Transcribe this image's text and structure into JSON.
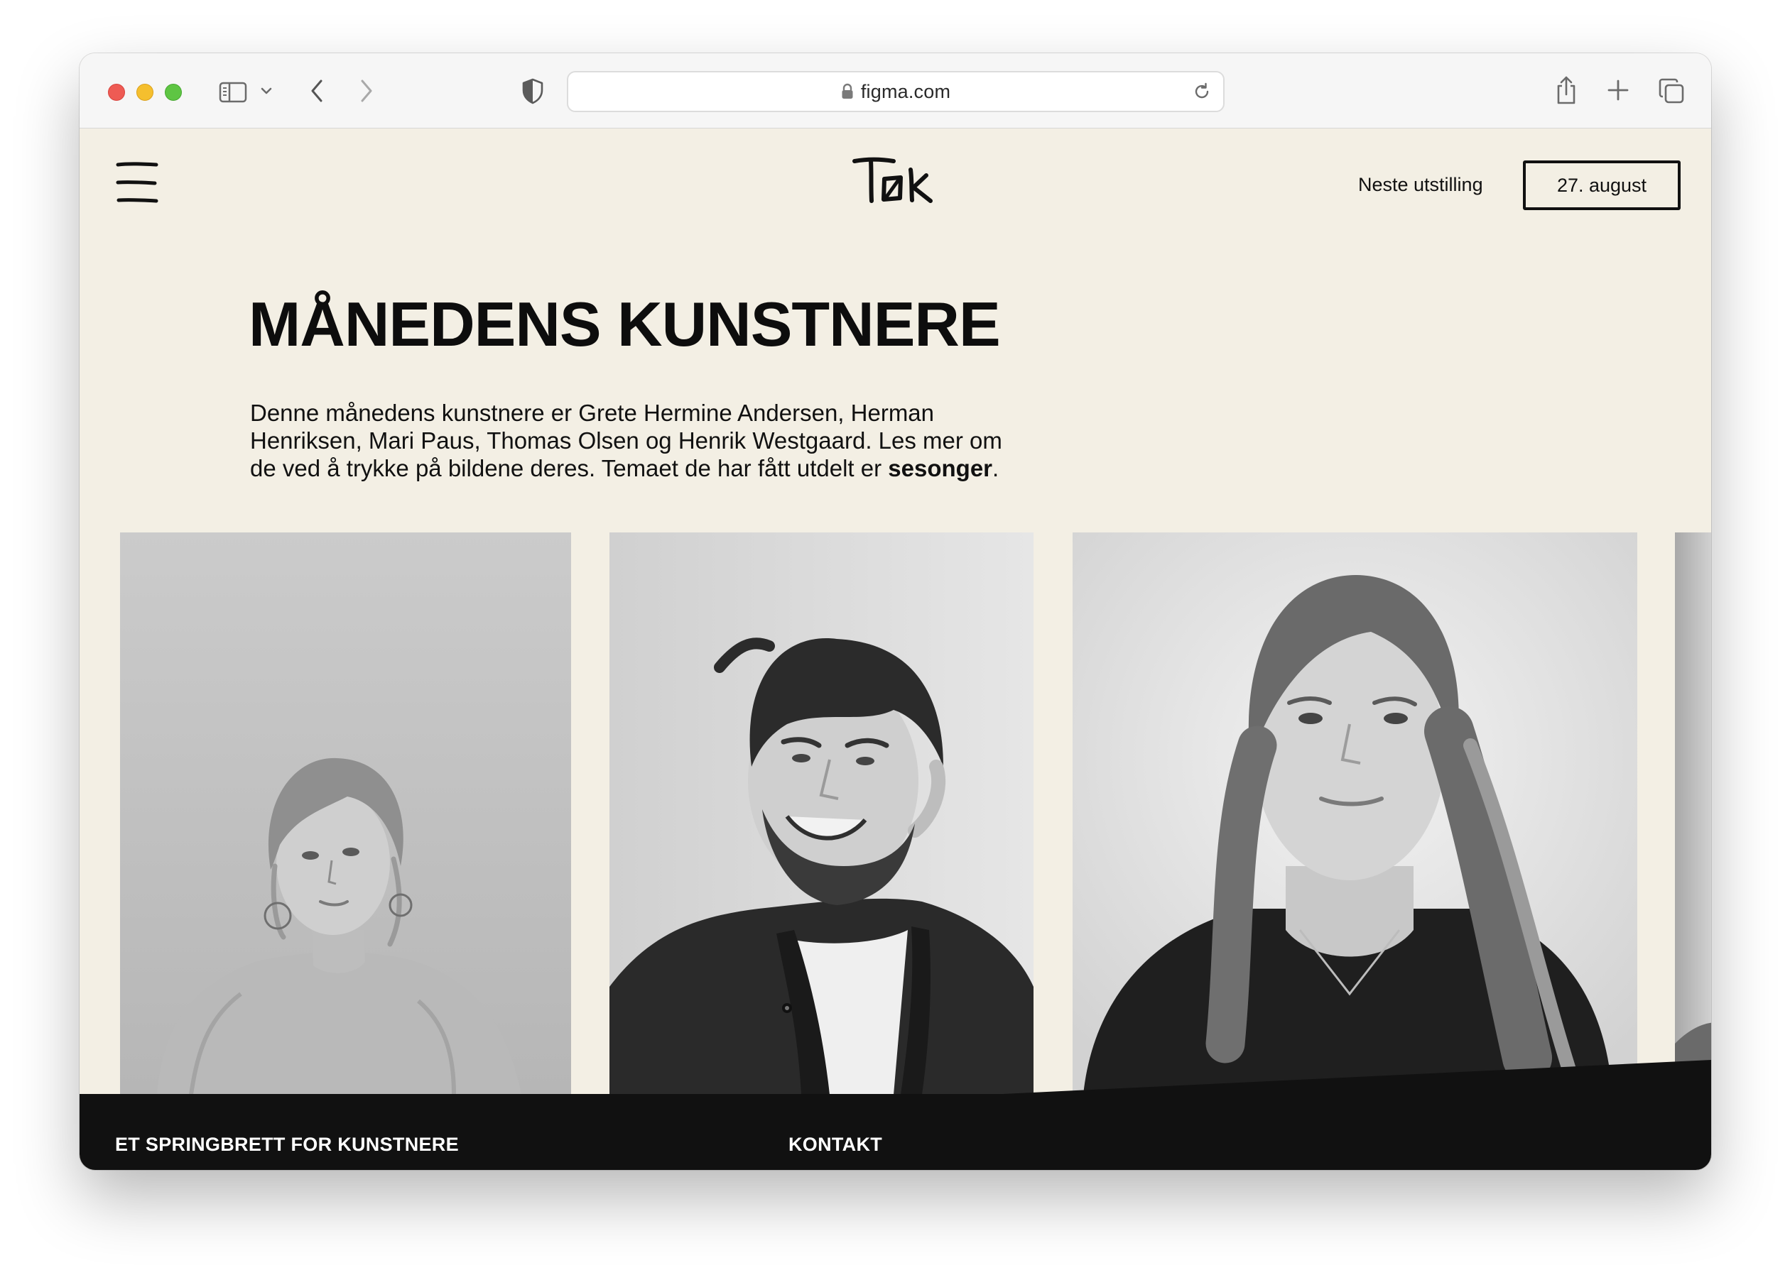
{
  "browser": {
    "url": "figma.com"
  },
  "header": {
    "logo_text": "Tak",
    "next_exhibition_label": "Neste utstilling",
    "next_exhibition_date": "27. august"
  },
  "main": {
    "title": "MÅNEDENS KUNSTNERE",
    "intro_before": "Denne månedens kunstnere er Grete Hermine Andersen, Herman Henriksen, Mari Paus, Thomas Olsen og Henrik Westgaard. Les mer om de ved å trykke på bildene deres. Temaet de har fått utdelt er ",
    "intro_bold": "sesonger",
    "intro_after": "."
  },
  "footer": {
    "heading_1": "ET SPRINGBRETT FOR KUNSTNERE",
    "heading_2": "KONTAKT"
  },
  "colors": {
    "page_background": "#f3efe4",
    "text": "#111111",
    "footer_background": "#111111",
    "footer_text": "#ffffff"
  },
  "icons": {
    "menu": "hamburger-menu-icon",
    "sidebar": "sidebar-icon",
    "back": "chevron-left-icon",
    "forward": "chevron-right-icon",
    "privacy": "shield-icon",
    "lock": "lock-icon",
    "reload": "reload-icon",
    "share": "share-icon",
    "new_tab": "plus-icon",
    "tabs": "tab-overview-icon"
  }
}
